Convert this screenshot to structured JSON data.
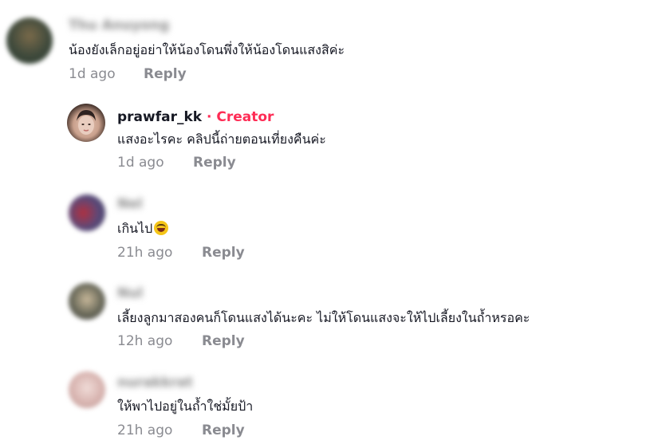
{
  "comments": [
    {
      "username": "Thu Anuyong",
      "text": "น้องยังเล็กอยู่อย่าให้น้องโดนพึ่งให้น้องโดนแสงสิค่ะ",
      "time": "1d ago",
      "reply": "Reply",
      "avatar_color": "#3f4a3c"
    },
    {
      "username": "prawfar_kk",
      "creator_tag": " · Creator",
      "text": "แสงอะไรคะ คลิปนี้ถ่ายตอนเที่ยงคืนค่ะ",
      "time": "1d ago",
      "reply": "Reply",
      "avatar_color": "#c9a89a"
    },
    {
      "username": "Nel",
      "text": "เกินไป",
      "time": "21h ago",
      "reply": "Reply",
      "avatar_color": "#5a4a7a"
    },
    {
      "username": "Nul",
      "text": "เลี้ยงลูกมาสองคนก็โดนแสงได้นะคะ ไม่ให้โดนแสงจะให้ไปเลี้ยงในถ้ำหรอคะ",
      "time": "12h ago",
      "reply": "Reply",
      "avatar_color": "#6a6a5a"
    },
    {
      "username": "nurakkrat",
      "text": "ให้พาไปอยู่ในถ้ำใช่มั้ยป้า",
      "time": "21h ago",
      "reply": "Reply",
      "avatar_color": "#d8b4b0"
    }
  ]
}
